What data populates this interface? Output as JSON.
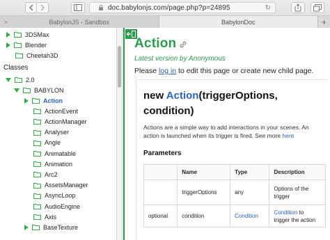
{
  "browser": {
    "url": "doc.babylonjs.com/page.php?p=24895",
    "tabs": [
      {
        "label": "BabylonJS - Sandbox",
        "active": false
      },
      {
        "label": "BabylonDoc",
        "active": true
      }
    ],
    "new_tab_label": "+"
  },
  "sidebar": {
    "top_items": [
      {
        "label": "3DSMax",
        "expanded": false
      },
      {
        "label": "Blender",
        "expanded": false
      },
      {
        "label": "Cheetah3D",
        "expanded": null
      }
    ],
    "section_label": "Classes",
    "version": {
      "label": "2.0",
      "expanded": true
    },
    "namespace": {
      "label": "BABYLON",
      "expanded": true
    },
    "classes": [
      {
        "label": "Action",
        "expanded": false,
        "selected": true
      },
      {
        "label": "ActionEvent"
      },
      {
        "label": "ActionManager"
      },
      {
        "label": "Analyser"
      },
      {
        "label": "Angle"
      },
      {
        "label": "Animatable"
      },
      {
        "label": "Animation"
      },
      {
        "label": "Arc2"
      },
      {
        "label": "AssetsManager"
      },
      {
        "label": "AsyncLoop"
      },
      {
        "label": "AudioEngine"
      },
      {
        "label": "Axis"
      },
      {
        "label": "BaseTexture",
        "expanded": false
      }
    ]
  },
  "main": {
    "title": "Action",
    "subtitle": "Latest version by Anonymous",
    "login_prefix": "Please ",
    "login_link": "log in",
    "login_suffix": " to edit this page or create new child page.",
    "class_prefix": "new ",
    "class_name": "Action",
    "class_args": "(triggerOptions, condition)",
    "description": "Actions are a simple way to add interactions in your scenes. An action is launched when its trigger is fired. See more ",
    "description_link": "here",
    "params_title": "Parameters",
    "params_headers": [
      "",
      "Name",
      "Type",
      "Description"
    ],
    "params_rows": [
      {
        "flag": "",
        "name": "triggerOptions",
        "type": "any",
        "description": "Options of the trigger"
      },
      {
        "flag": "optional",
        "name": "condition",
        "type": "Condition",
        "description_link": "Condition",
        "description": " to trigger the action"
      }
    ]
  },
  "colors": {
    "accent_green": "#2e9a4d",
    "link_blue": "#2b63b6"
  }
}
